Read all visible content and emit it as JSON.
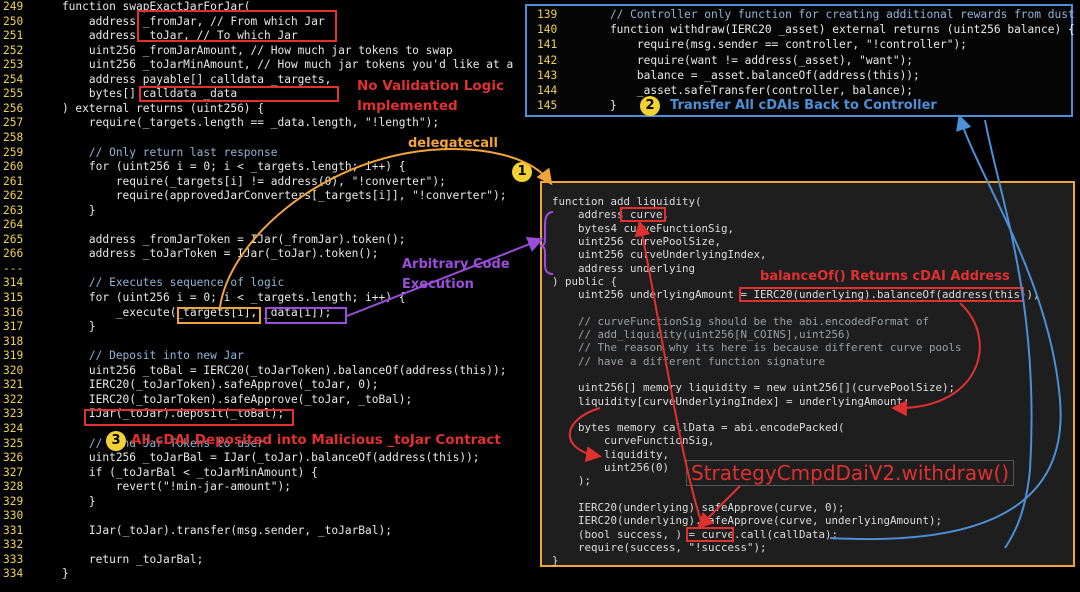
{
  "left_code": [
    {
      "n": "249",
      "t": "    function swapExactJarForJar("
    },
    {
      "n": "250",
      "t": "        address _fromJar, // From which Jar"
    },
    {
      "n": "251",
      "t": "        address _toJar, // To which Jar"
    },
    {
      "n": "252",
      "t": "        uint256 _fromJarAmount, // How much jar tokens to swap"
    },
    {
      "n": "253",
      "t": "        uint256 _toJarMinAmount, // How much jar tokens you'd like at a"
    },
    {
      "n": "254",
      "t": "        address payable[] calldata _targets,"
    },
    {
      "n": "255",
      "t": "        bytes[] calldata _data"
    },
    {
      "n": "256",
      "t": "    ) external returns (uint256) {"
    },
    {
      "n": "257",
      "t": "        require(_targets.length == _data.length, \"!length\");"
    },
    {
      "n": "258",
      "t": ""
    },
    {
      "n": "259",
      "t": "        // Only return last response"
    },
    {
      "n": "260",
      "t": "        for (uint256 i = 0; i < _targets.length; i++) {"
    },
    {
      "n": "261",
      "t": "            require(_targets[i] != address(0), \"!converter\");"
    },
    {
      "n": "262",
      "t": "            require(approvedJarConverters[_targets[i]], \"!converter\");"
    },
    {
      "n": "263",
      "t": "        }"
    },
    {
      "n": "264",
      "t": ""
    },
    {
      "n": "265",
      "t": "        address _fromJarToken = IJar(_fromJar).token();"
    },
    {
      "n": "266",
      "t": "        address _toJarToken = IJar(_toJar).token();"
    },
    {
      "n": "---",
      "t": ""
    },
    {
      "n": "314",
      "t": "        // Executes sequence of logic"
    },
    {
      "n": "315",
      "t": "        for (uint256 i = 0; i < _targets.length; i++) {"
    },
    {
      "n": "316",
      "t": "            _execute(_targets[i], _data[i]);"
    },
    {
      "n": "317",
      "t": "        }"
    },
    {
      "n": "318",
      "t": ""
    },
    {
      "n": "319",
      "t": "        // Deposit into new Jar"
    },
    {
      "n": "320",
      "t": "        uint256 _toBal = IERC20(_toJarToken).balanceOf(address(this));"
    },
    {
      "n": "321",
      "t": "        IERC20(_toJarToken).safeApprove(_toJar, 0);"
    },
    {
      "n": "322",
      "t": "        IERC20(_toJarToken).safeApprove(_toJar, _toBal);"
    },
    {
      "n": "323",
      "t": "        IJar(_toJar).deposit(_toBal);"
    },
    {
      "n": "324",
      "t": ""
    },
    {
      "n": "325",
      "t": "        // Send Jar Tokens to user"
    },
    {
      "n": "326",
      "t": "        uint256 _toJarBal = IJar(_toJar).balanceOf(address(this));"
    },
    {
      "n": "327",
      "t": "        if (_toJarBal < _toJarMinAmount) {"
    },
    {
      "n": "328",
      "t": "            revert(\"!min-jar-amount\");"
    },
    {
      "n": "329",
      "t": "        }"
    },
    {
      "n": "330",
      "t": ""
    },
    {
      "n": "331",
      "t": "        IJar(_toJar).transfer(msg.sender, _toJarBal);"
    },
    {
      "n": "332",
      "t": ""
    },
    {
      "n": "333",
      "t": "        return _toJarBal;"
    },
    {
      "n": "334",
      "t": "    }"
    }
  ],
  "top_code": [
    {
      "n": "139",
      "t": "    // Controller only function for creating additional rewards from dust"
    },
    {
      "n": "140",
      "t": "    function withdraw(IERC20 _asset) external returns (uint256 balance) {"
    },
    {
      "n": "141",
      "t": "        require(msg.sender == controller, \"!controller\");"
    },
    {
      "n": "142",
      "t": "        require(want != address(_asset), \"want\");"
    },
    {
      "n": "143",
      "t": "        balance = _asset.balanceOf(address(this));"
    },
    {
      "n": "144",
      "t": "        _asset.safeTransfer(controller, balance);"
    },
    {
      "n": "145",
      "t": "    }"
    }
  ],
  "main_code": [
    "function add_liquidity(",
    "    address curve,",
    "    bytes4 curveFunctionSig,",
    "    uint256 curvePoolSize,",
    "    uint256 curveUnderlyingIndex,",
    "    address underlying",
    ") public {",
    "    uint256 underlyingAmount = IERC20(underlying).balanceOf(address(this));",
    "",
    "    // curveFunctionSig should be the abi.encodedFormat of",
    "    // add_liquidity(uint256[N_COINS],uint256)",
    "    // The reason why its here is because different curve pools",
    "    // have a different function signature",
    "",
    "    uint256[] memory liquidity = new uint256[](curvePoolSize);",
    "    liquidity[curveUnderlyingIndex] = underlyingAmount;",
    "",
    "    bytes memory callData = abi.encodePacked(",
    "        curveFunctionSig,",
    "        liquidity,",
    "        uint256(0)",
    "    );",
    "",
    "    IERC20(underlying).safeApprove(curve, 0);",
    "    IERC20(underlying).safeApprove(curve, underlyingAmount);",
    "    (bool success, ) = curve.call(callData);",
    "    require(success, \"!success\");",
    "}"
  ],
  "annotations": {
    "no_validation_1": "No Validation Logic",
    "no_validation_2": "Implemented",
    "delegatecall": "delegatecall",
    "arbitrary_1": "Arbitrary Code",
    "arbitrary_2": "Execution",
    "balanceof": "balanceOf() Returns cDAI Address",
    "strategy": "StrategyCmpdDaiV2.withdraw()",
    "transfer": "Transfer All cDAIs Back to Controller",
    "deposited": "All cDAI Deposited into Malicious _toJar Contract"
  },
  "badges": {
    "one": "1",
    "two": "2",
    "three": "3"
  },
  "colors": {
    "red": "#e03030",
    "orange": "#f0a43a",
    "purple": "#9b4ddb",
    "blue": "#4d8fd6",
    "yellow": "#f2d233",
    "line_number": "#f0d34a"
  }
}
